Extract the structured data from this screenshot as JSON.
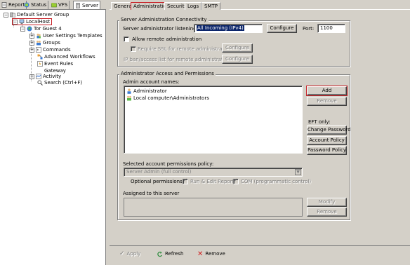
{
  "left_tabs": [
    {
      "label": "Report",
      "icon": "report-icon"
    },
    {
      "label": "Status",
      "icon": "status-icon"
    },
    {
      "label": "VFS",
      "icon": "folder-icon"
    },
    {
      "label": "Server",
      "icon": "server-icon"
    }
  ],
  "tree": {
    "root": "Default Server Group",
    "localhost": "LocalHost",
    "site": "Tor Guest 4",
    "children": [
      "User Settings Templates",
      "Groups",
      "Commands",
      "Advanced Workflows",
      "Event Rules",
      "Gateway",
      "Activity",
      "Search (Ctrl+F)"
    ]
  },
  "right_tabs": [
    "General",
    "Administration",
    "Security",
    "Logs",
    "SMTP"
  ],
  "connectivity": {
    "title": "Server Administration Connectivity",
    "listen_label": "Server administrator listening IP:",
    "listen_value": "All Incoming (IPv4)",
    "configure_label": "Configure",
    "port_label": "Port:",
    "port_value": "1100",
    "allow_remote_label": "Allow remote administration",
    "require_ssl_label": "Require SSL for remote administration:",
    "ip_ban_label": "IP ban/access list for remote administration:",
    "configure_ssl_label": "Configure",
    "configure_ip_label": "Configure"
  },
  "access": {
    "title": "Administrator Access and Permissions",
    "accounts_label": "Admin account names:",
    "accounts": [
      "Administrator",
      "Local computer\\Administrators"
    ],
    "add_label": "Add",
    "remove_label": "Remove",
    "eft_only_label": "EFT only:",
    "change_password_label": "Change Password",
    "account_policy_label": "Account Policy",
    "password_policy_label": "Password Policy",
    "policy_label": "Selected account permissions policy:",
    "policy_value": "Server Admin (full control)",
    "optional_label": "Optional permissions:",
    "run_edit_label": "Run & Edit Reports",
    "com_label": "COM (programmatic control)",
    "assigned_label": "Assigned to this server",
    "modify_label": "Modify",
    "remove2_label": "Remove"
  },
  "bottom": {
    "apply_label": "Apply",
    "refresh_label": "Refresh",
    "remove_label": "Remove"
  },
  "colors": {
    "highlight_red": "#c8242a",
    "selection_blue": "#0a246a"
  }
}
